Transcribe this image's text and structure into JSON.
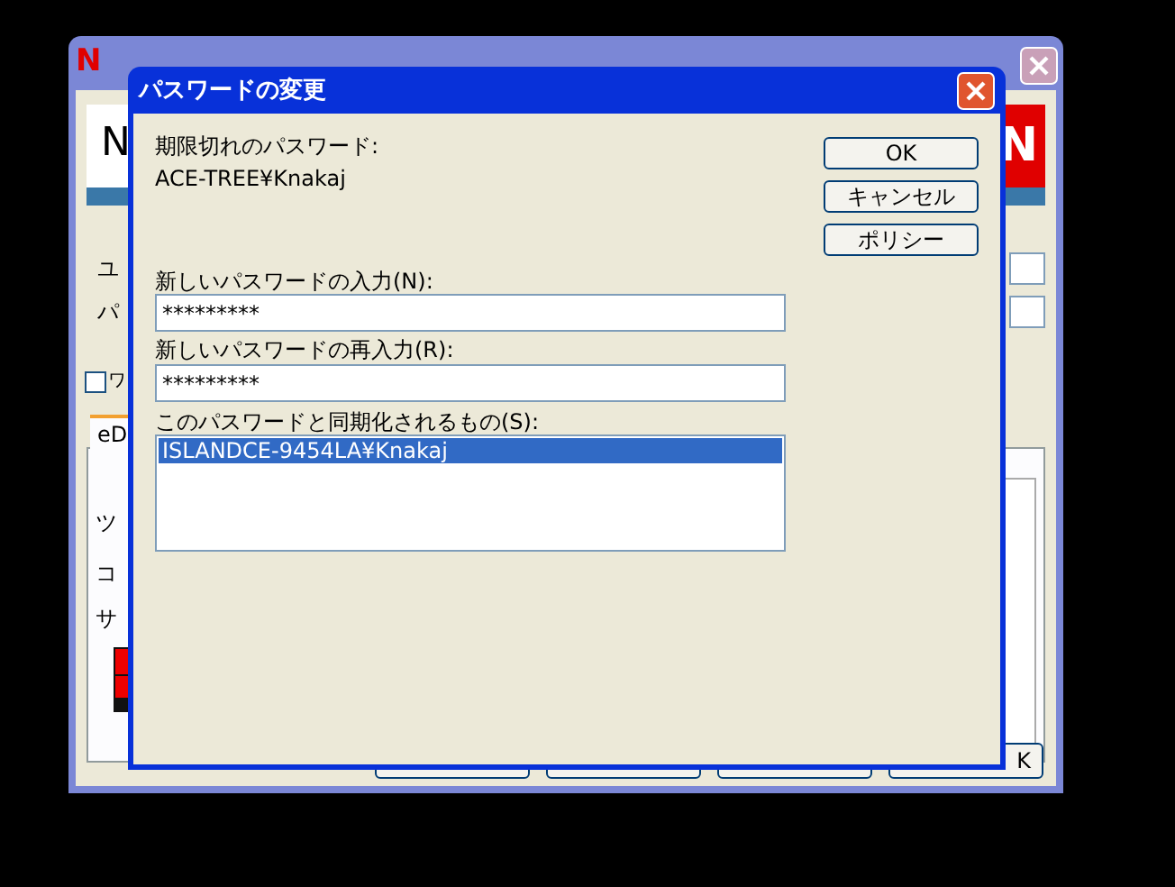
{
  "background_window": {
    "logo": "N",
    "banner_logo": "N",
    "banner_logo_right": "N",
    "labels": [
      "ユ",
      "パ"
    ],
    "checkbox": {
      "label": "ワ",
      "checked": false
    },
    "tab": {
      "label": "eD",
      "selected": true
    },
    "tab_items": [
      "ツ",
      "コ",
      "サ"
    ],
    "last_button": "K"
  },
  "dialog": {
    "title": "パスワードの変更",
    "expired_label": "期限切れのパスワード:",
    "expired_value": "ACE-TREE¥Knakaj",
    "new_password": {
      "label": "新しいパスワードの入力(N):",
      "value": "*********"
    },
    "confirm_password": {
      "label": "新しいパスワードの再入力(R):",
      "value": "*********"
    },
    "sync": {
      "label": "このパスワードと同期化されるもの(S):",
      "items": [
        {
          "text": "ISLANDCE-9454LA¥Knakaj",
          "selected": true
        }
      ]
    },
    "buttons": [
      {
        "label": "OK"
      },
      {
        "label": "キャンセル"
      },
      {
        "label": "ポリシー"
      }
    ]
  }
}
